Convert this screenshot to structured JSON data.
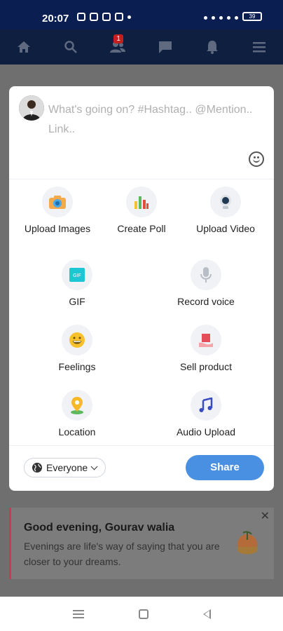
{
  "status_bar": {
    "time": "20:07",
    "battery": "39"
  },
  "nav": {
    "items": [
      {
        "icon": "home-icon"
      },
      {
        "icon": "search-icon"
      },
      {
        "icon": "friends-icon",
        "badge": "1"
      },
      {
        "icon": "chat-icon"
      },
      {
        "icon": "bell-icon"
      },
      {
        "icon": "menu-icon"
      }
    ]
  },
  "composer": {
    "placeholder": "What's going on? #Hashtag.. @Mention.. Link..",
    "actions": [
      {
        "label": "Upload Images",
        "icon": "camera-icon"
      },
      {
        "label": "Create Poll",
        "icon": "poll-icon"
      },
      {
        "label": "Upload Video",
        "icon": "video-icon"
      },
      {
        "label": "GIF",
        "icon": "gif-icon"
      },
      {
        "label": "Record voice",
        "icon": "microphone-icon"
      },
      {
        "label": "Feelings",
        "icon": "smile-emoji-icon"
      },
      {
        "label": "Sell product",
        "icon": "product-icon"
      },
      {
        "label": "Location",
        "icon": "location-pin-icon"
      },
      {
        "label": "Audio Upload",
        "icon": "music-note-icon"
      }
    ],
    "privacy": "Everyone",
    "share_label": "Share",
    "share_color": "#4a90e2"
  },
  "greeting": {
    "title": "Good evening, Gourav walia",
    "text": "Evenings are life's way of saying that you are closer to your dreams.",
    "close": "✕"
  }
}
